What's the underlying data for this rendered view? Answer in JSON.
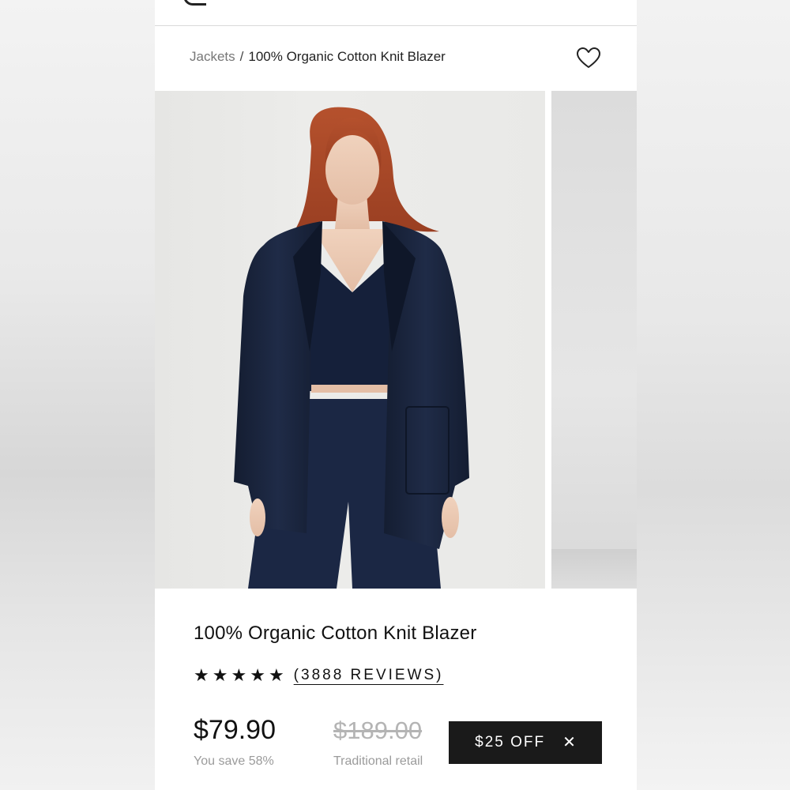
{
  "breadcrumb": {
    "parent": "Jackets",
    "separator": "/",
    "current": "100% Organic Cotton Knit Blazer"
  },
  "header": {
    "favorite_icon": "heart-icon"
  },
  "gallery": {
    "main_image": "model wearing navy knit blazer",
    "next_image": "studio backdrop"
  },
  "product": {
    "title": "100% Organic Cotton Knit Blazer",
    "rating": {
      "stars": 5,
      "star_glyph": "★",
      "reviews_label": "(3888 REVIEWS)"
    },
    "price": "$79.90",
    "savings": "You save 58%",
    "retail_price": "$189.00",
    "retail_label": "Traditional retail"
  },
  "promo": {
    "label": "$25 OFF",
    "close_glyph": "✕",
    "close_icon": "close-icon"
  },
  "colors": {
    "accent": "#1a1a1a",
    "navy": "#1c2a45",
    "muted_text": "#9b9b9b"
  }
}
